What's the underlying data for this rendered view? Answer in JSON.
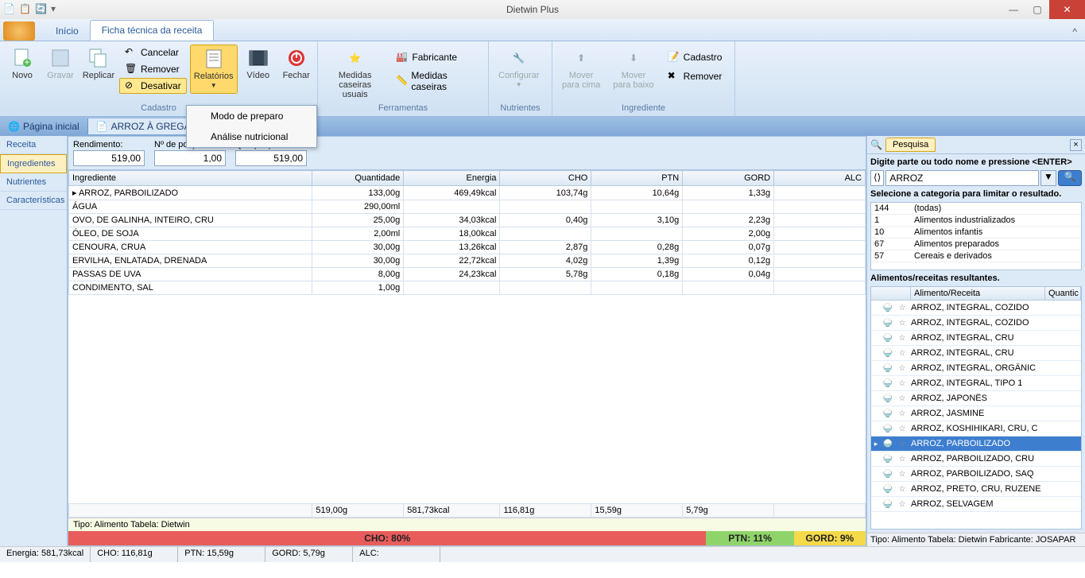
{
  "app": {
    "title": "Dietwin Plus"
  },
  "tabs": {
    "inicio": "Início",
    "ficha": "Ficha técnica da receita"
  },
  "ribbon": {
    "novo": "Novo",
    "gravar": "Gravar",
    "replicar": "Replicar",
    "cancelar": "Cancelar",
    "remover": "Remover",
    "desativar": "Desativar",
    "relatorios": "Relatórios",
    "video": "Vídeo",
    "fechar": "Fechar",
    "g_cadastro": "Cadastro",
    "medidas_usuais": "Medidas\ncaseiras usuais",
    "fabricante": "Fabricante",
    "medidas_caseiras": "Medidas caseiras",
    "g_ferramentas": "Ferramentas",
    "configurar": "Configurar",
    "g_nutrientes": "Nutrientes",
    "mover_cima": "Mover\npara cima",
    "mover_baixo": "Mover\npara baixo",
    "cadastro2": "Cadastro",
    "remover2": "Remover",
    "g_ingrediente": "Ingrediente"
  },
  "dropdown": {
    "modo": "Modo de preparo",
    "analise": "Análise nutricional"
  },
  "doctabs": {
    "home": "Página inicial",
    "recipe": "ARROZ À GREGA  (REP"
  },
  "sidetabs": {
    "receita": "Receita",
    "ingredientes": "Ingredientes",
    "nutrientes": "Nutrientes",
    "caracteristicas": "Características"
  },
  "yield": {
    "rendimento_l": "Rendimento:",
    "rendimento_v": "519,00",
    "porcoes_l": "Nº de porções:",
    "porcoes_v": "1,00",
    "qtd_l": "Qtd. porção:",
    "qtd_v": "519,00"
  },
  "grid": {
    "headers": [
      "Ingrediente",
      "Quantidade",
      "Energia",
      "CHO",
      "PTN",
      "GORD",
      "ALC"
    ],
    "rows": [
      {
        "n": "ARROZ, PARBOILIZADO",
        "q": "133,00g",
        "e": "469,49kcal",
        "c": "103,74g",
        "p": "10,64g",
        "g": "1,33g",
        "a": ""
      },
      {
        "n": "ÁGUA",
        "q": "290,00ml",
        "e": "",
        "c": "",
        "p": "",
        "g": "",
        "a": ""
      },
      {
        "n": "OVO, DE GALINHA, INTEIRO, CRU",
        "q": "25,00g",
        "e": "34,03kcal",
        "c": "0,40g",
        "p": "3,10g",
        "g": "2,23g",
        "a": ""
      },
      {
        "n": "ÓLEO, DE SOJA",
        "q": "2,00ml",
        "e": "18,00kcal",
        "c": "",
        "p": "",
        "g": "2,00g",
        "a": ""
      },
      {
        "n": "CENOURA, CRUA",
        "q": "30,00g",
        "e": "13,26kcal",
        "c": "2,87g",
        "p": "0,28g",
        "g": "0,07g",
        "a": ""
      },
      {
        "n": "ERVILHA, ENLATADA, DRENADA",
        "q": "30,00g",
        "e": "22,72kcal",
        "c": "4,02g",
        "p": "1,39g",
        "g": "0,12g",
        "a": ""
      },
      {
        "n": "PASSAS DE UVA",
        "q": "8,00g",
        "e": "24,23kcal",
        "c": "5,78g",
        "p": "0,18g",
        "g": "0,04g",
        "a": ""
      },
      {
        "n": "CONDIMENTO, SAL",
        "q": "1,00g",
        "e": "",
        "c": "",
        "p": "",
        "g": "",
        "a": ""
      }
    ],
    "totals": {
      "q": "519,00g",
      "e": "581,73kcal",
      "c": "116,81g",
      "p": "15,59g",
      "g": "5,79g",
      "a": ""
    }
  },
  "typebar": "Tipo: Alimento  Tabela: Dietwin",
  "bars": {
    "cho": "CHO: 80%",
    "ptn": "PTN: 11%",
    "gord": "GORD: 9%"
  },
  "status": {
    "energia": "Energia: 581,73kcal",
    "cho": "CHO: 116,81g",
    "ptn": "PTN: 15,59g",
    "gord": "GORD: 5,79g",
    "alc": "ALC:"
  },
  "search": {
    "tab": "Pesquisa",
    "hint": "Digite parte ou todo nome e pressione <ENTER>",
    "value": "ARROZ",
    "cat_label": "Selecione a categoria para limitar o resultado.",
    "categories": [
      {
        "c": "144",
        "n": "(todas)"
      },
      {
        "c": "1",
        "n": "Alimentos industrializados"
      },
      {
        "c": "10",
        "n": "Alimentos infantis"
      },
      {
        "c": "67",
        "n": "Alimentos preparados"
      },
      {
        "c": "57",
        "n": "Cereais e derivados"
      }
    ],
    "res_label": "Alimentos/receitas resultantes.",
    "res_headers": {
      "name": "Alimento/Receita",
      "q": "Quantic"
    },
    "results": [
      "ARROZ, INTEGRAL, COZIDO",
      "ARROZ, INTEGRAL, COZIDO",
      "ARROZ, INTEGRAL, CRU",
      "ARROZ, INTEGRAL, CRU",
      "ARROZ, INTEGRAL, ORGÂNIC",
      "ARROZ, INTEGRAL, TIPO 1",
      "ARROZ, JAPONÊS",
      "ARROZ, JASMINE",
      "ARROZ, KOSHIHIKARI, CRU, C",
      "ARROZ, PARBOILIZADO",
      "ARROZ, PARBOILIZADO, CRU",
      "ARROZ, PARBOILIZADO, SAQ",
      "ARROZ, PRETO, CRU, RUZENE",
      "ARROZ, SELVAGEM"
    ],
    "selected_index": 9,
    "status": "Tipo: Alimento  Tabela: Dietwin  Fabricante: JOSAPAR"
  }
}
